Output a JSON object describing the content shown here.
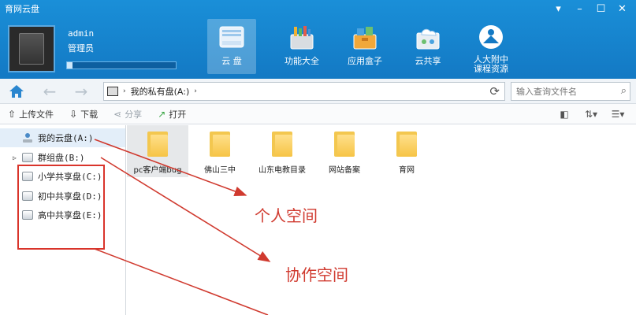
{
  "window": {
    "title": "育网云盘"
  },
  "user": {
    "name": "admin",
    "role": "管理员",
    "quota_fraction": 0.05
  },
  "topnav": [
    {
      "label": "云 盘",
      "icon": "cloud-disk-icon",
      "active": true
    },
    {
      "label": "功能大全",
      "icon": "toolbox-icon"
    },
    {
      "label": "应用盒子",
      "icon": "app-box-icon"
    },
    {
      "label": "云共享",
      "icon": "cloud-share-icon"
    },
    {
      "label": "人大附中",
      "label2": "课程资源",
      "icon": "rdfz-logo-icon"
    }
  ],
  "address": {
    "path": "我的私有盘(A:)"
  },
  "search": {
    "placeholder": "输入查询文件名"
  },
  "toolbar": {
    "upload": "上传文件",
    "download": "下载",
    "share": "分享",
    "open": "打开"
  },
  "sidebar": {
    "items": [
      {
        "label": "我的云盘(A:)"
      },
      {
        "label": "群组盘(B:)"
      },
      {
        "label": "小学共享盘(C:)"
      },
      {
        "label": "初中共享盘(D:)"
      },
      {
        "label": "高中共享盘(E:)"
      }
    ]
  },
  "files": [
    {
      "name": "pc客户端bug"
    },
    {
      "name": "佛山三中"
    },
    {
      "name": "山东电教目录"
    },
    {
      "name": "网站备案"
    },
    {
      "name": "育网"
    }
  ],
  "annotations": {
    "personal": "个人空间",
    "collab": "协作空间"
  },
  "colors": {
    "header": "#1a8fd8",
    "annotation": "#d03a2f"
  }
}
